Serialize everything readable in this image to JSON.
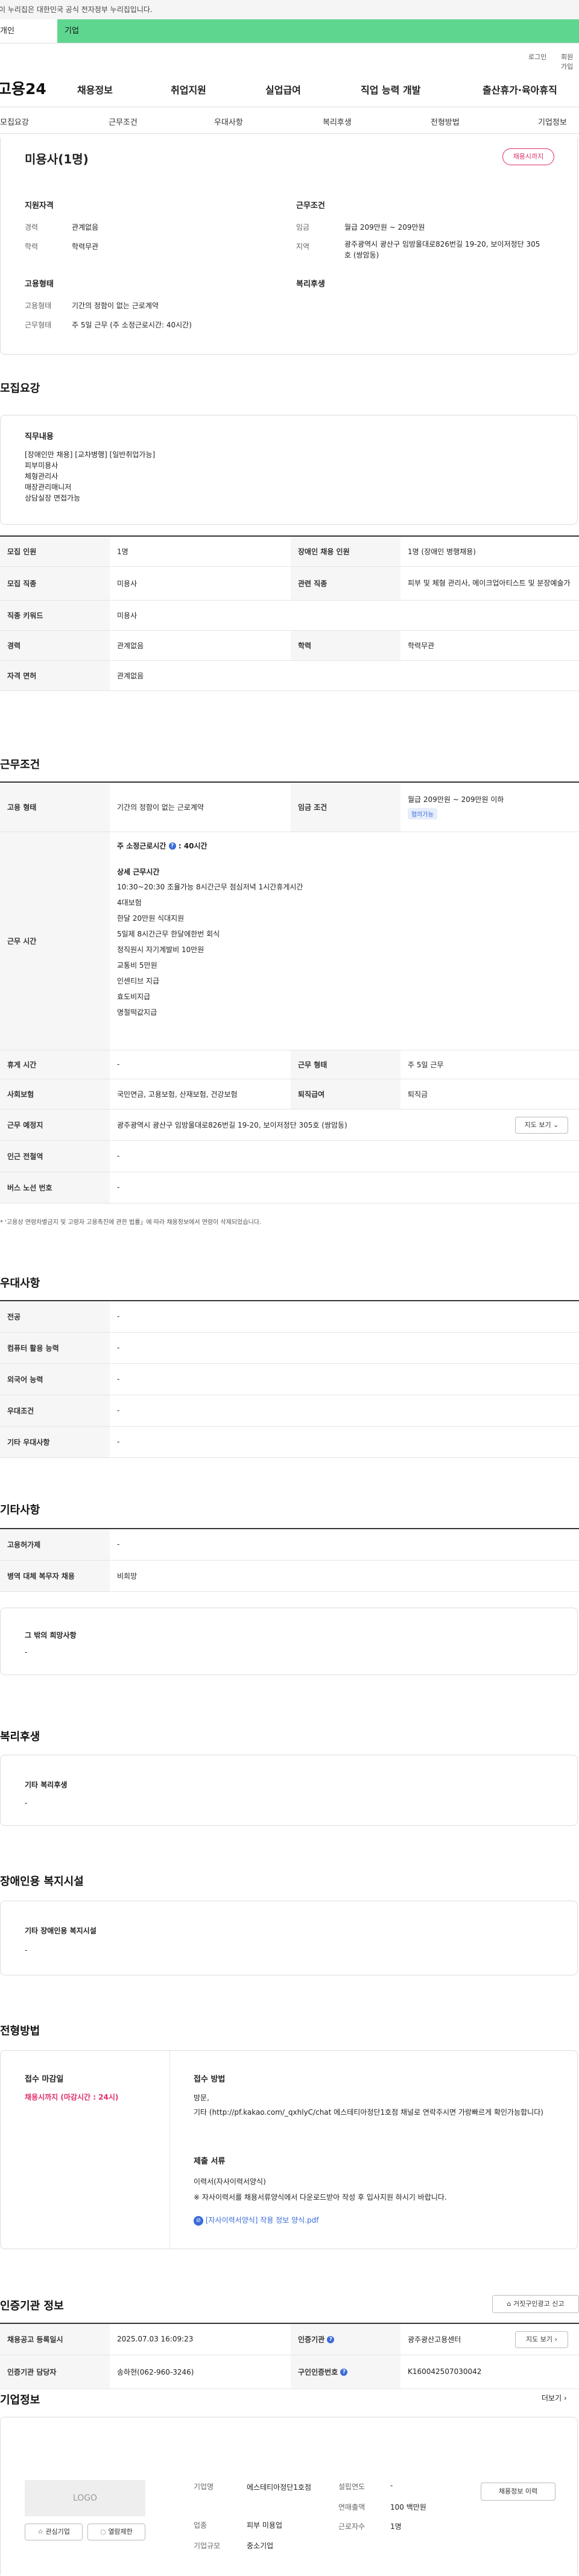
{
  "gov_banner": "이 누리집은 대한민국 공식 전자정부 누리집입니다.",
  "top_tabs": [
    "개인",
    "기업"
  ],
  "util": [
    "로그인",
    "회원가입"
  ],
  "logo": "고용24",
  "gnb": [
    "채용정보",
    "취업지원",
    "실업급여",
    "직업 능력 개발",
    "출산휴가·육아휴직"
  ],
  "subnav": [
    "모집요강",
    "근무조건",
    "우대사항",
    "복리후생",
    "전형방법",
    "기업정보"
  ],
  "job_title": "미용사(1명)",
  "status_badge": "채용시까지",
  "summary": {
    "qual_title": "지원자격",
    "career_label": "경력",
    "career": "관계없음",
    "edu_label": "학력",
    "edu": "학력무관",
    "cond_title": "근무조건",
    "wage_label": "임금",
    "wage": "월급 209만원 ~ 209만원",
    "region_label": "지역",
    "region": "광주광역시 광산구 임방울대로826번길 19-20, 보이저정단 305호 (쌍암동)",
    "emp_title": "고용형태",
    "emp_type_label": "고용형태",
    "emp_type": "기간의 정함이 없는 근로계약",
    "work_type_label": "근무형태",
    "work_type": "주 5일 근무 (주 소정근로시간: 40시간)",
    "welfare_title": "복리후생"
  },
  "recruit": {
    "title": "모집요강",
    "duty_title": "직무내용",
    "duty_lines": [
      "[장애인만 채용] [교차병행] [일반취업가능]",
      "피부미용사",
      "체형관리사",
      "매장관리매니저",
      "상담실장 면접가능"
    ],
    "rows": [
      {
        "l1": "모집 인원",
        "v1": "1명",
        "l2": "장애인 채용 인원",
        "v2": "1명 (장애인 병행채용)"
      },
      {
        "l1": "모집 직종",
        "v1": "미용사",
        "l2": "관련 직종",
        "v2": "피부 및 체형 관리사, 메이크업아티스트 및 분장예술가"
      },
      {
        "l1": "직종 키워드",
        "v1": "미용사"
      },
      {
        "l1": "경력",
        "v1": "관계없음",
        "l2": "학력",
        "v2": "학력무관"
      },
      {
        "l1": "자격 면허",
        "v1": "관계없음"
      }
    ]
  },
  "conditions": {
    "title": "근무조건",
    "emp_label": "고용 형태",
    "emp": "기간의 정함이 없는 근로계약",
    "wage_label": "임금 조건",
    "wage": "월급 209만원 ~ 209만원 이하",
    "wage_pill": "협의가능",
    "hours_label": "근무 시간",
    "weekly_hours": "주 소정근로시간",
    "weekly_hours_val": ": 40시간",
    "detail_title": "상세 근무시간",
    "detail_lines": [
      "10:30~20:30 조율가능 8시간근무 점심저녁 1시간휴게시간",
      "4대보험",
      "한달 20만원 식대지원",
      "5일제 8시간근무 한달에한번 회식",
      "정직원시 자기계발비 10만원",
      "교통비 5만원",
      "인센티브 지급",
      "효도비지급",
      "명절떡값지급"
    ],
    "holiday_label": "휴게 시간",
    "holiday": "-",
    "worktype_label": "근무 형태",
    "worktype": "주 5일 근무",
    "insurance_label": "사회보험",
    "insurance": "국민연금, 고용보험, 산재보험, 건강보험",
    "retire_label": "퇴직급여",
    "retire": "퇴직금",
    "addr_label": "근무 예정지",
    "addr": "광주광역시 광산구 임방울대로826번길 19-20, 보이저정단 305호 (쌍암동)",
    "map_btn": "지도 보기",
    "subway_label": "인근 전철역",
    "subway": "-",
    "bus_label": "버스 노선 번호",
    "bus": "-",
    "note": "* '고용상 연령차별금지 및 고령자 고용촉진에 관한 법률」에 따라 채용정보에서 연령이 삭제되었습니다."
  },
  "pref": {
    "title": "우대사항",
    "rows": [
      [
        "전공",
        "-"
      ],
      [
        "컴퓨터 활용 능력",
        "-"
      ],
      [
        "외국어 능력",
        "-"
      ],
      [
        "우대조건",
        "-"
      ],
      [
        "기타 우대사항",
        "-"
      ]
    ]
  },
  "etc": {
    "title": "기타사항",
    "rows": [
      [
        "고용허가제",
        "-"
      ],
      [
        "병역 대체 복무자 채용",
        "비희망"
      ]
    ],
    "wish_title": "그 밖의 희망사항",
    "wish": "-"
  },
  "welfare": {
    "title": "복리후생",
    "card_title": "기타 복리후생",
    "card_val": "-"
  },
  "disabled": {
    "title": "장애인용 복지시설",
    "card_title": "기타 장애인용 복지시설",
    "card_val": "-"
  },
  "selection": {
    "title": "전형방법",
    "deadline_title": "접수 마감일",
    "deadline": "채용시까지 (마감시간 : 24시)",
    "method_title": "접수 방법",
    "method_lines": [
      "방문,",
      "기타 (http://pf.kakao.com/_qxhlyC/chat 에스테티아정단1호점 채널로 연락주시면 가랑빠르게 확인가능합니다)"
    ],
    "docs_title": "제출 서류",
    "docs_lines": [
      "이력서(자사이력서양식)",
      "※ 자사이력서를 채용서류양식에서 다운로드받아 작성 후 입사지원 하시기 바랍니다."
    ],
    "file": "[자사이력서양식] 작용 정보 양식.pdf"
  },
  "agency": {
    "title": "인증기관 정보",
    "report_btn": "거짓구인광고 신고",
    "reg_label": "채용공고 등록일시",
    "reg": "2025.07.03 16:09:23",
    "org_label": "인증기관",
    "org": "광주광산고용센터",
    "map_btn": "지도 보기",
    "mgr_label": "인증기관 담당자",
    "mgr": "송하현(062-960-3246)",
    "num_label": "구인인증번호",
    "num": "K160042507030042"
  },
  "company": {
    "title": "기업정보",
    "more": "더보기",
    "logo": "LOGO",
    "fav_btn": "관심기업",
    "block_btn": "열람제한",
    "name_label": "기업명",
    "name": "에스테티아정단1호점",
    "founded_label": "설립연도",
    "founded": "-",
    "industry_label": "업종",
    "industry": "피부 미용업",
    "sales_label": "연매출액",
    "sales": "100 백만원",
    "scale_label": "기업규모",
    "scale": "중소기업",
    "employees_label": "근로자수",
    "employees": "1명",
    "history_btn": "채용정보 이력"
  }
}
